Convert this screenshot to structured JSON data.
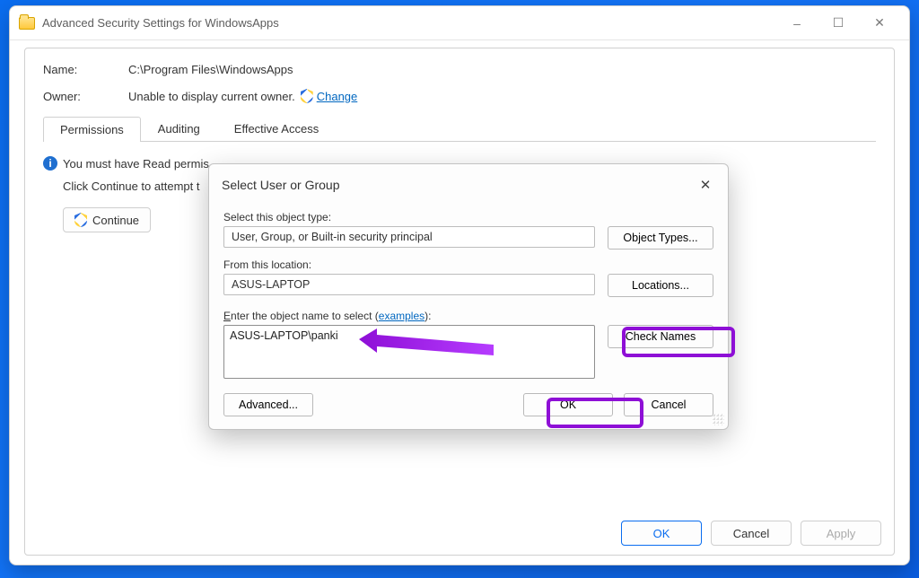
{
  "window": {
    "title": "Advanced Security Settings for WindowsApps",
    "name_label": "Name:",
    "name_value": "C:\\Program Files\\WindowsApps",
    "owner_label": "Owner:",
    "owner_value": "Unable to display current owner.",
    "change_link": "Change",
    "tabs": [
      "Permissions",
      "Auditing",
      "Effective Access"
    ],
    "active_tab": 0,
    "info_msg": "You must have Read permis",
    "continue_msg": "Click Continue to attempt t",
    "continue_btn": "Continue",
    "ok": "OK",
    "cancel": "Cancel",
    "apply": "Apply"
  },
  "dialog": {
    "title": "Select User or Group",
    "object_type_label": "Select this object type:",
    "object_type_value": "User, Group, or Built-in security principal",
    "object_types_btn": "Object Types...",
    "location_label": "From this location:",
    "location_value": "ASUS-LAPTOP",
    "locations_btn": "Locations...",
    "enter_label_pre": "E",
    "enter_label_rest": "nter the object name to select (",
    "examples_link": "examples",
    "enter_label_end": "):",
    "object_name_value": "ASUS-LAPTOP\\panki",
    "check_names_btn": "Check Names",
    "advanced_btn": "Advanced...",
    "ok": "OK",
    "cancel": "Cancel"
  }
}
